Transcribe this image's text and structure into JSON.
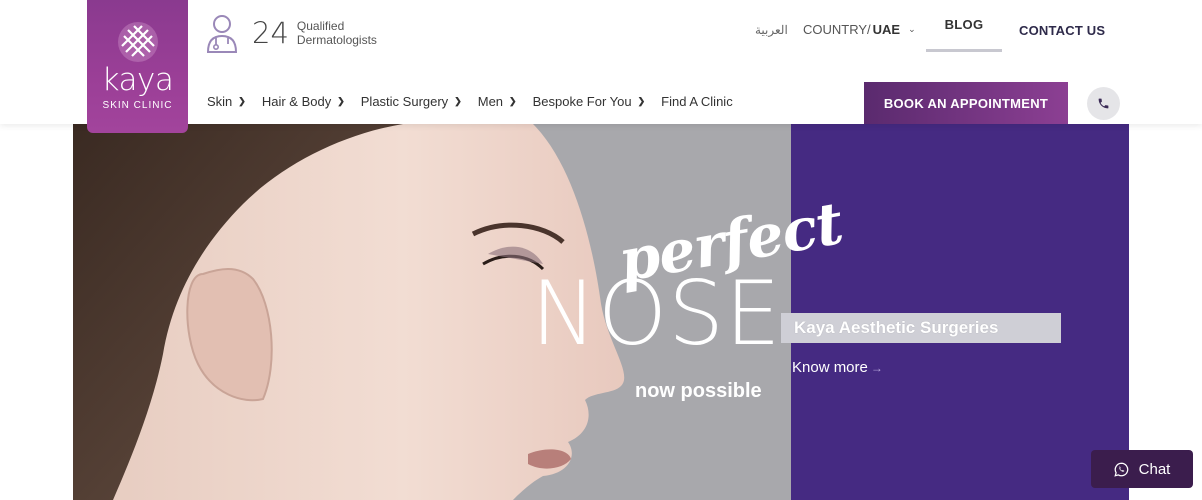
{
  "brand": {
    "logo_word": "kaya",
    "logo_sub": "SKIN CLINIC",
    "accent": "#8a3a8f"
  },
  "derm": {
    "count": "24",
    "line1": "Qualified",
    "line2": "Dermatologists",
    "icon": "doctor-icon"
  },
  "topbar": {
    "arabic": "العربية",
    "country_label": "COUNTRY/",
    "country_value": "UAE",
    "blog": "BLOG",
    "contact": "CONTACT US"
  },
  "nav": {
    "items": [
      {
        "label": "Skin",
        "dropdown": true
      },
      {
        "label": "Hair & Body",
        "dropdown": true
      },
      {
        "label": "Plastic Surgery",
        "dropdown": true
      },
      {
        "label": "Men",
        "dropdown": true
      },
      {
        "label": "Bespoke For You",
        "dropdown": true
      },
      {
        "label": "Find A Clinic",
        "dropdown": false
      }
    ],
    "book": "BOOK AN APPOINTMENT",
    "phone_icon": "phone-icon"
  },
  "hero": {
    "perfect": "perfect",
    "nose": "NOSE",
    "now_possible": "now possible",
    "surgeries": "Kaya Aesthetic Surgeries",
    "know_more": "Know more",
    "right_bg": "#452a82"
  },
  "chat": {
    "label": "Chat",
    "icon": "whatsapp-icon"
  }
}
